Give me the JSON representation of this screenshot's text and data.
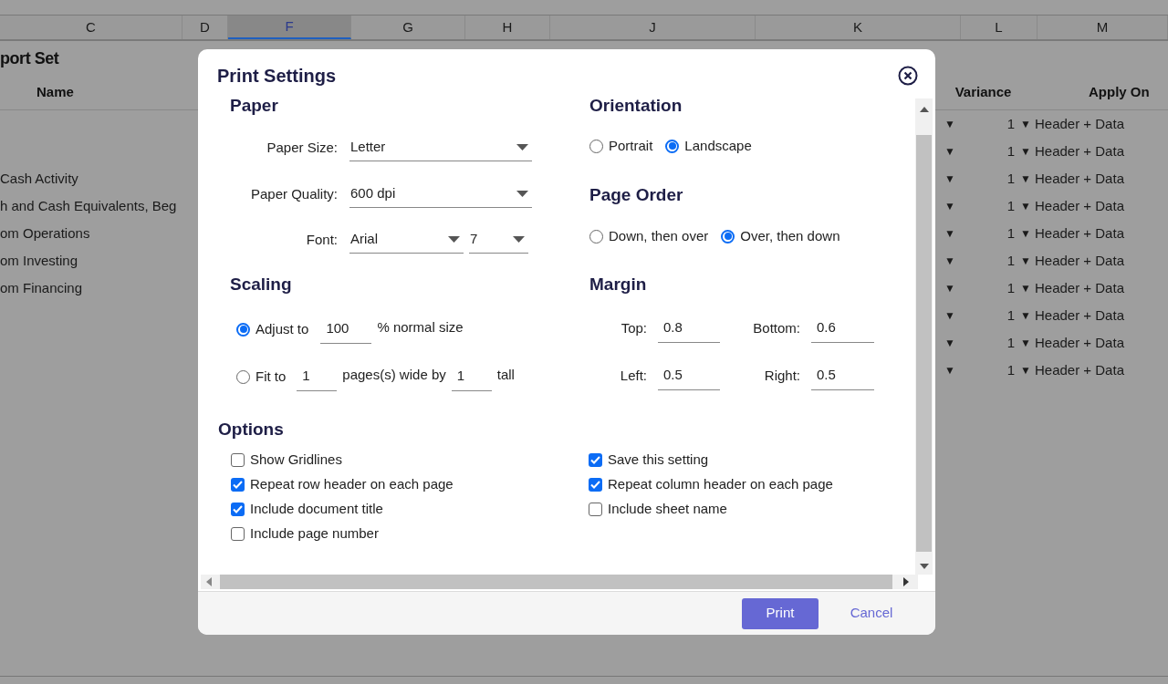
{
  "spreadsheet": {
    "columns": [
      {
        "label": "C",
        "selected": false
      },
      {
        "label": "D",
        "selected": false
      },
      {
        "label": "F",
        "selected": true
      },
      {
        "label": "G",
        "selected": false
      },
      {
        "label": "H",
        "selected": false
      },
      {
        "label": "J",
        "selected": false
      },
      {
        "label": "K",
        "selected": false
      },
      {
        "label": "L",
        "selected": false
      },
      {
        "label": "M",
        "selected": false
      }
    ],
    "title": "port Set",
    "header": {
      "column_c": "Name",
      "variance": "Variance",
      "apply_on": "Apply On"
    },
    "rows": [
      {
        "column_c": "",
        "marker": "▼",
        "variance": "1",
        "variance_marker": "▼",
        "apply_on": "Header + Data"
      },
      {
        "column_c": "",
        "marker": "▼",
        "variance": "1",
        "variance_marker": "▼",
        "apply_on": "Header + Data"
      },
      {
        "column_c": "Cash Activity",
        "marker": "▼",
        "variance": "1",
        "variance_marker": "▼",
        "apply_on": "Header + Data"
      },
      {
        "column_c": "h and Cash Equivalents, Beg",
        "marker": "▼",
        "variance": "1",
        "variance_marker": "▼",
        "apply_on": "Header + Data"
      },
      {
        "column_c": "om Operations",
        "marker": "▼",
        "variance": "1",
        "variance_marker": "▼",
        "apply_on": "Header + Data"
      },
      {
        "column_c": "om Investing",
        "marker": "▼",
        "variance": "1",
        "variance_marker": "▼",
        "apply_on": "Header + Data"
      },
      {
        "column_c": "om Financing",
        "marker": "▼",
        "variance": "1",
        "variance_marker": "▼",
        "apply_on": "Header + Data"
      },
      {
        "column_c": "",
        "marker": "▼",
        "variance": "1",
        "variance_marker": "▼",
        "apply_on": "Header + Data"
      },
      {
        "column_c": "",
        "marker": "▼",
        "variance": "1",
        "variance_marker": "▼",
        "apply_on": "Header + Data"
      },
      {
        "column_c": "",
        "marker": "▼",
        "variance": "1",
        "variance_marker": "▼",
        "apply_on": "Header + Data"
      }
    ]
  },
  "dialog": {
    "title": "Print Settings",
    "paper": {
      "heading": "Paper",
      "paper_size": {
        "label": "Paper Size:",
        "value": "Letter"
      },
      "paper_quality": {
        "label": "Paper Quality:",
        "value": "600 dpi"
      },
      "font": {
        "label": "Font:",
        "value": "Arial",
        "size": "7"
      }
    },
    "scaling": {
      "heading": "Scaling",
      "options": [
        {
          "kind": "adjust",
          "selected": true,
          "label": "Adjust to",
          "value": "100",
          "suffix": "% normal size"
        },
        {
          "kind": "fit",
          "selected": false,
          "label": "Fit to",
          "wide": "1",
          "middle": "pages(s) wide by",
          "tall": "1",
          "suffix": "tall"
        }
      ]
    },
    "orientation": {
      "heading": "Orientation",
      "options": [
        {
          "label": "Portrait",
          "selected": false
        },
        {
          "label": "Landscape",
          "selected": true
        }
      ]
    },
    "page_order": {
      "heading": "Page Order",
      "options": [
        {
          "label": "Down, then over",
          "selected": false
        },
        {
          "label": "Over, then down",
          "selected": true
        }
      ]
    },
    "margin": {
      "heading": "Margin",
      "fields": [
        {
          "label": "Top:",
          "value": "0.8"
        },
        {
          "label": "Bottom:",
          "value": "0.6"
        },
        {
          "label": "Left:",
          "value": "0.5"
        },
        {
          "label": "Right:",
          "value": "0.5"
        }
      ]
    },
    "options": {
      "heading": "Options",
      "left": [
        {
          "label": "Show Gridlines",
          "checked": false
        },
        {
          "label": "Repeat row header on each page",
          "checked": true
        },
        {
          "label": "Include document title",
          "checked": true
        },
        {
          "label": "Include page number",
          "checked": false
        }
      ],
      "right": [
        {
          "label": "Save this setting",
          "checked": true
        },
        {
          "label": "Repeat column header on each page",
          "checked": true
        },
        {
          "label": "Include sheet name",
          "checked": false
        }
      ]
    },
    "buttons": {
      "print": "Print",
      "cancel": "Cancel"
    }
  }
}
